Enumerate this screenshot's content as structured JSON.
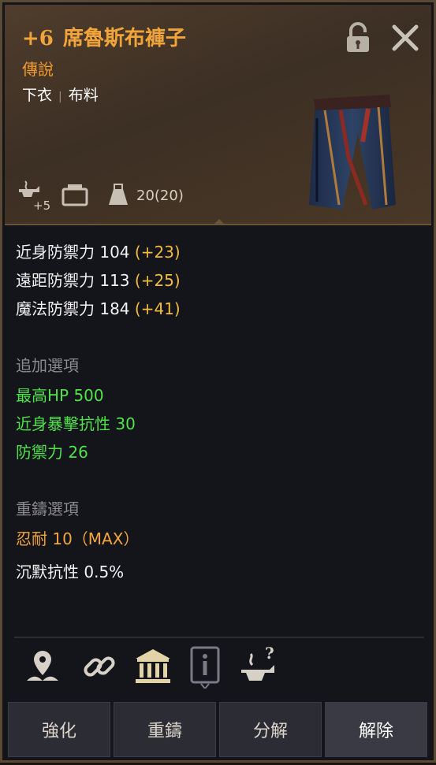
{
  "item": {
    "enhance": "+6",
    "name": "席魯斯布褲子",
    "grade": "傳說",
    "slot": "下衣",
    "material": "布料",
    "enhance_level_badge": "+5",
    "weight": "20(20)"
  },
  "stats": [
    {
      "label": "近身防禦力 104",
      "bonus": "(+23)"
    },
    {
      "label": "遠距防禦力 113",
      "bonus": "(+25)"
    },
    {
      "label": "魔法防禦力 184",
      "bonus": "(+41)"
    }
  ],
  "extra_options": {
    "heading": "追加選項",
    "items": [
      "最高HP 500",
      "近身暴擊抗性 30",
      "防禦力 26"
    ]
  },
  "reforge_options": {
    "heading": "重鑄選項",
    "items": [
      "忍耐 10（MAX）",
      "沉默抗性 0.5%"
    ]
  },
  "icons": [
    "location-pin-icon",
    "link-icon",
    "bank-icon",
    "card-info-icon",
    "anvil-help-icon"
  ],
  "buttons": [
    "強化",
    "重鑄",
    "分解",
    "解除"
  ],
  "colors": {
    "grade": "#f29b2b",
    "bonus": "#f2bd3a",
    "extra": "#4fe34a",
    "reforge_highlight": "#f3a63a"
  }
}
